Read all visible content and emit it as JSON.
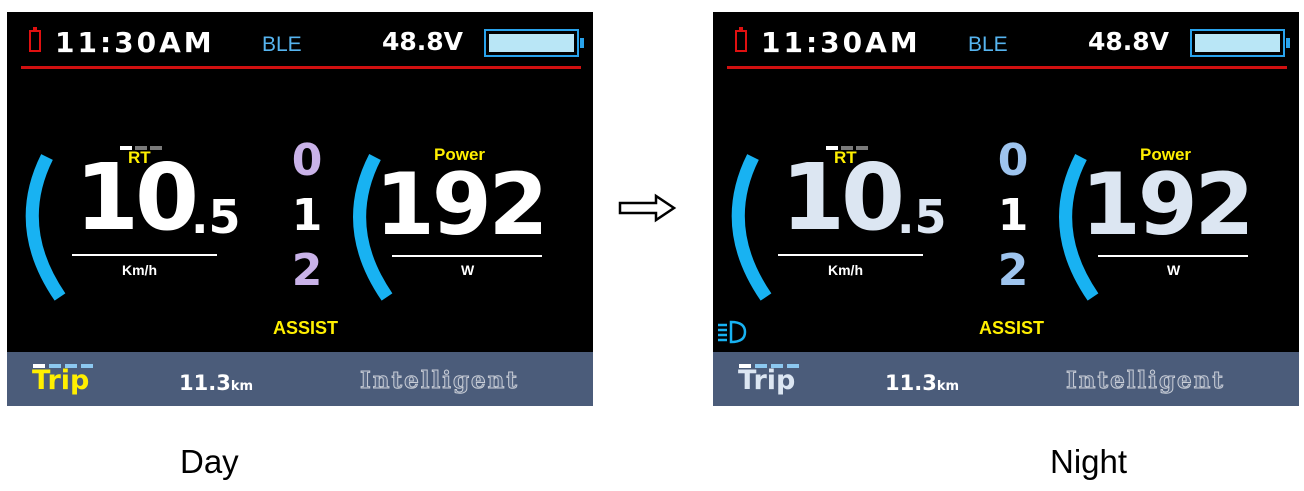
{
  "displays": [
    {
      "id": "day",
      "time": "11:30AM",
      "ble_label": "BLE",
      "voltage": "48.8V",
      "battery_level": 1.0,
      "rt_label": "RT",
      "speed_integer": "10",
      "speed_decimal": ".5",
      "speed_unit": "Km/h",
      "assist_levels": [
        "0",
        "1",
        "2"
      ],
      "power_label": "Power",
      "power_value": "192",
      "power_unit": "W",
      "assist_label": "ASSIST",
      "trip_label": "Trip",
      "trip_distance": "11.3",
      "trip_unit": "km",
      "mode_label": "Intelligent",
      "headlight_on": false,
      "colors": {
        "trip_label": "#ffef00",
        "level_0": "#c9b2e8",
        "level_1": "#ffffff",
        "level_2": "#c9b2e8"
      }
    },
    {
      "id": "night",
      "time": "11:30AM",
      "ble_label": "BLE",
      "voltage": "48.8V",
      "battery_level": 1.0,
      "rt_label": "RT",
      "speed_integer": "10",
      "speed_decimal": ".5",
      "speed_unit": "Km/h",
      "assist_levels": [
        "0",
        "1",
        "2"
      ],
      "power_label": "Power",
      "power_value": "192",
      "power_unit": "W",
      "assist_label": "ASSIST",
      "trip_label": "Trip",
      "trip_distance": "11.3",
      "trip_unit": "km",
      "mode_label": "Intelligent",
      "headlight_on": true,
      "colors": {
        "trip_label": "#dce6f2",
        "level_0": "#9ec4ee",
        "level_1": "#ffffff",
        "level_2": "#9ec4ee"
      }
    }
  ],
  "captions": {
    "day": "Day",
    "night": "Night"
  },
  "icons": {
    "arrow": "right-arrow-icon",
    "battery": "battery-icon",
    "headlight": "headlight-icon"
  }
}
